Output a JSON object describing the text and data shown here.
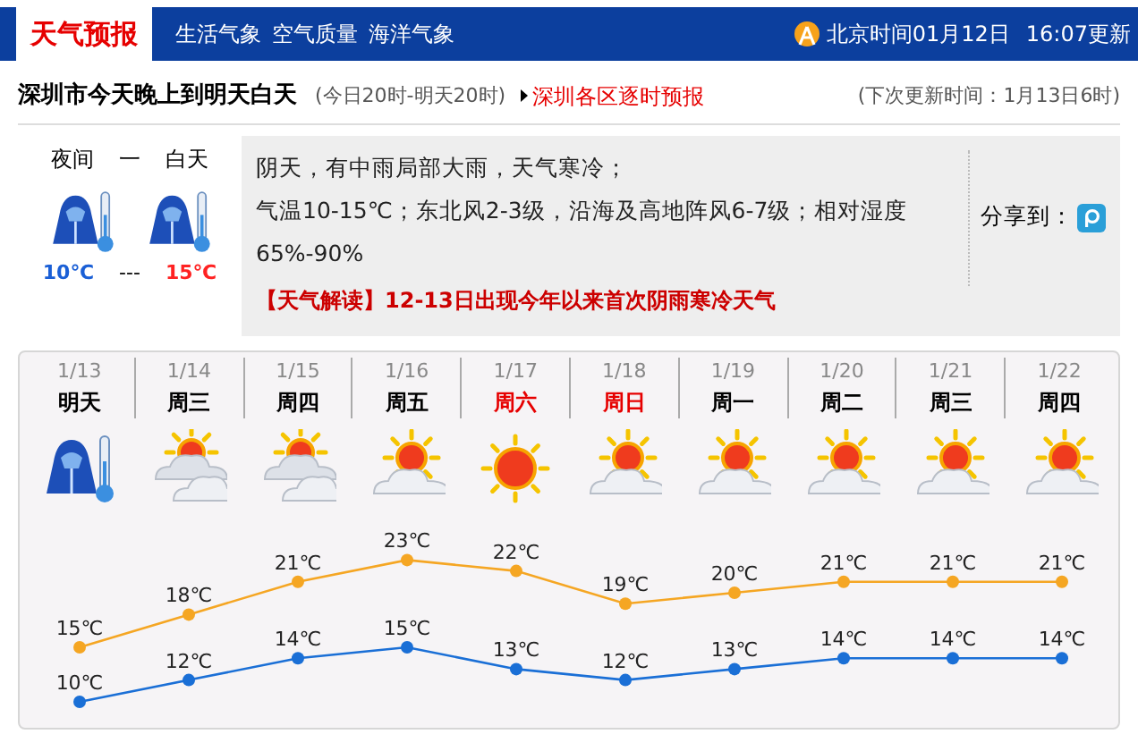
{
  "header": {
    "tabs": [
      {
        "label": "天气预报",
        "selected": true
      },
      {
        "label": "生活气象",
        "selected": false
      },
      {
        "label": "空气质量",
        "selected": false
      },
      {
        "label": "海洋气象",
        "selected": false
      }
    ],
    "time": "北京时间01月12日",
    "updated": "16:07更新"
  },
  "subheader": {
    "title": "深圳市今天晚上到明天白天",
    "range": "(今日20时-明天20时)",
    "link": "深圳各区逐时预报",
    "next_update": "(下次更新时间：1月13日6时)"
  },
  "tonight": {
    "night_label": "夜间",
    "dash": "一",
    "day_label": "白天",
    "low": "10℃",
    "separator": "---",
    "high": "15℃"
  },
  "summary": {
    "line1": "阴天，有中雨局部大雨，天气寒冷；",
    "line2": "气温10-15℃；东北风2-3级，沿海及高地阵风6-7级；相对湿度65%-90%",
    "share": "分享到：",
    "notice": "【天气解读】12-13日出现今年以来首次阴雨寒冷天气"
  },
  "days": [
    {
      "date": "1/13",
      "day": "明天",
      "weekend": false,
      "kind": "cold"
    },
    {
      "date": "1/14",
      "day": "周三",
      "weekend": false,
      "kind": "cloudy"
    },
    {
      "date": "1/15",
      "day": "周四",
      "weekend": false,
      "kind": "cloudy"
    },
    {
      "date": "1/16",
      "day": "周五",
      "weekend": false,
      "kind": "partly"
    },
    {
      "date": "1/17",
      "day": "周六",
      "weekend": true,
      "kind": "sunny"
    },
    {
      "date": "1/18",
      "day": "周日",
      "weekend": true,
      "kind": "partly"
    },
    {
      "date": "1/19",
      "day": "周一",
      "weekend": false,
      "kind": "partly"
    },
    {
      "date": "1/20",
      "day": "周二",
      "weekend": false,
      "kind": "partly"
    },
    {
      "date": "1/21",
      "day": "周三",
      "weekend": false,
      "kind": "partly"
    },
    {
      "date": "1/22",
      "day": "周四",
      "weekend": false,
      "kind": "partly"
    }
  ],
  "chart_data": {
    "type": "line",
    "series": [
      {
        "color": "#f5a623",
        "marker": "circle",
        "values": [
          15,
          18,
          21,
          23,
          22,
          19,
          20,
          21,
          21,
          21
        ],
        "value_labels": [
          "15℃",
          "18℃",
          "21℃",
          "23℃",
          "22℃",
          "19℃",
          "20℃",
          "21℃",
          "21℃",
          "21℃"
        ]
      },
      {
        "color": "#1a6fd6",
        "marker": "circle",
        "values": [
          10,
          12,
          14,
          15,
          13,
          12,
          13,
          14,
          14,
          14
        ],
        "value_labels": [
          "10℃",
          "12℃",
          "14℃",
          "15℃",
          "13℃",
          "12℃",
          "13℃",
          "14℃",
          "14℃",
          "14℃"
        ]
      }
    ]
  }
}
